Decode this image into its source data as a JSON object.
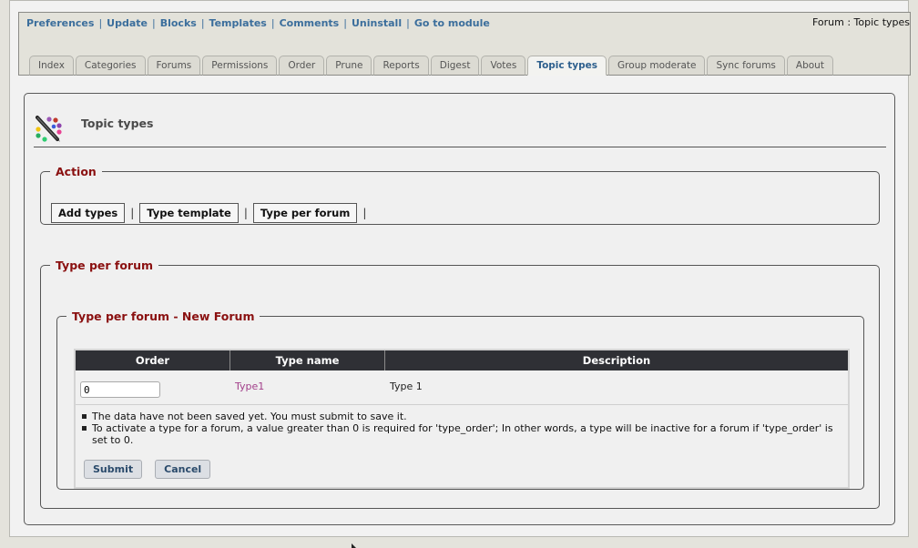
{
  "top_links": [
    "Preferences",
    "Update",
    "Blocks",
    "Templates",
    "Comments",
    "Uninstall",
    "Go to module"
  ],
  "breadcrumb": "Forum : Topic types",
  "tabs": [
    {
      "label": "Index",
      "active": false
    },
    {
      "label": "Categories",
      "active": false
    },
    {
      "label": "Forums",
      "active": false
    },
    {
      "label": "Permissions",
      "active": false
    },
    {
      "label": "Order",
      "active": false
    },
    {
      "label": "Prune",
      "active": false
    },
    {
      "label": "Reports",
      "active": false
    },
    {
      "label": "Digest",
      "active": false
    },
    {
      "label": "Votes",
      "active": false
    },
    {
      "label": "Topic types",
      "active": true
    },
    {
      "label": "Group moderate",
      "active": false
    },
    {
      "label": "Sync forums",
      "active": false
    },
    {
      "label": "About",
      "active": false
    }
  ],
  "page": {
    "title": "Topic types"
  },
  "action": {
    "legend": "Action",
    "buttons": [
      "Add types",
      "Type template",
      "Type per forum"
    ],
    "separator": "|"
  },
  "type_per_forum": {
    "legend": "Type per forum",
    "inner_legend": "Type per forum - New Forum",
    "columns": [
      "Order",
      "Type name",
      "Description"
    ],
    "rows": [
      {
        "order": "0",
        "type_name": "Type1",
        "description": "Type 1"
      }
    ],
    "notes": [
      "The data have not been saved yet. You must submit to save it.",
      "To activate a type for a forum, a value greater than 0 is required for 'type_order'; In other words, a type will be inactive for a forum if 'type_order' is set to 0."
    ],
    "submit_label": "Submit",
    "cancel_label": "Cancel"
  },
  "colors": {
    "link": "#3b6e9c",
    "legend": "#8a1010",
    "table_header": "#2f3035",
    "type_link": "#a23f8a"
  }
}
